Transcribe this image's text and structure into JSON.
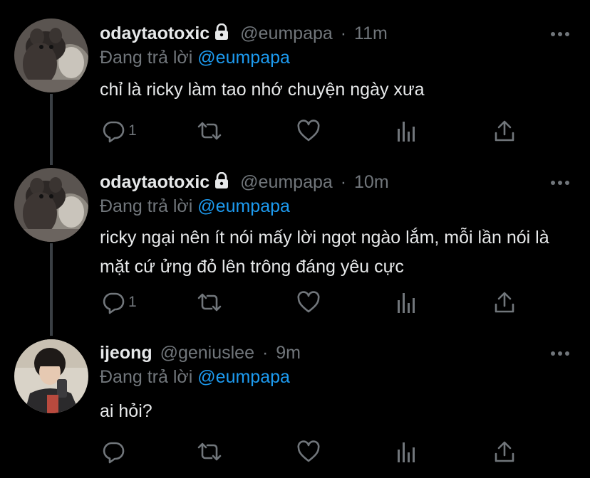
{
  "tweets": [
    {
      "name": "odaytaotoxic",
      "protected": true,
      "handle": "@eumpapa",
      "separator": "·",
      "time": "11m",
      "replying_prefix": "Đang trả lời",
      "replying_to": "@eumpapa",
      "text": "chỉ là ricky làm tao nhớ chuyện ngày xưa",
      "reply_count": "1"
    },
    {
      "name": "odaytaotoxic",
      "protected": true,
      "handle": "@eumpapa",
      "separator": "·",
      "time": "10m",
      "replying_prefix": "Đang trả lời",
      "replying_to": "@eumpapa",
      "text": "ricky ngại nên ít nói mấy lời ngọt ngào lắm, mỗi lần nói là mặt cứ ửng đỏ lên trông đáng yêu cực",
      "reply_count": "1"
    },
    {
      "name": "ijeong",
      "protected": false,
      "handle": "@geniuslee",
      "separator": "·",
      "time": "9m",
      "replying_prefix": "Đang trả lời",
      "replying_to": "@eumpapa",
      "text": "ai hỏi?",
      "reply_count": ""
    }
  ],
  "colors": {
    "background": "#000000",
    "text": "#e7e9ea",
    "muted": "#71767b",
    "link": "#1d9bf0",
    "thread_line": "#3a3f44"
  },
  "icons": [
    "more-icon",
    "lock-icon",
    "reply-icon",
    "retweet-icon",
    "like-icon",
    "analytics-icon",
    "share-icon"
  ]
}
